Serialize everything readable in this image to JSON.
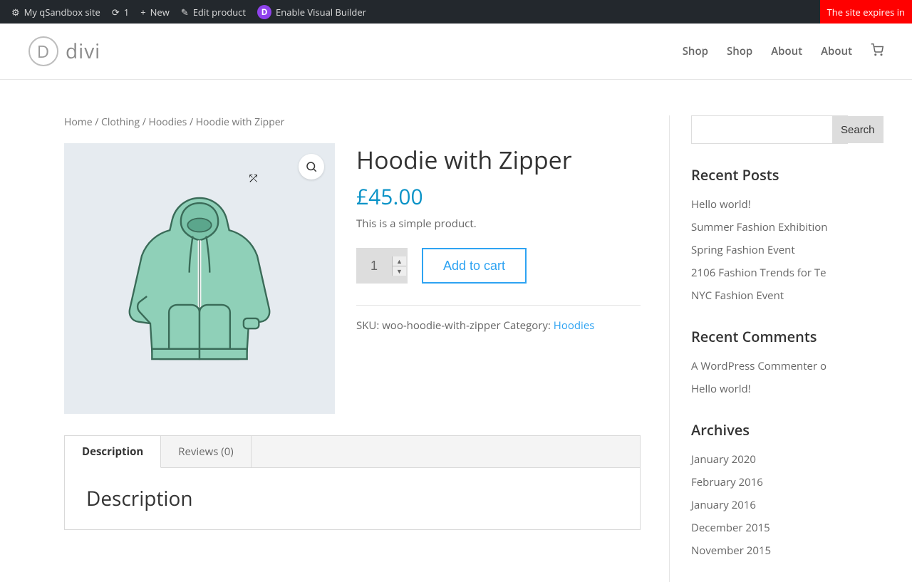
{
  "admin_bar": {
    "site_name": "My qSandbox site",
    "updates_count": "1",
    "new_label": "New",
    "edit_label": "Edit product",
    "visual_builder": "Enable Visual Builder",
    "expire_notice": "The site expires in"
  },
  "logo_text": "divi",
  "nav": [
    "Shop",
    "Shop",
    "About",
    "About"
  ],
  "breadcrumb": {
    "home": "Home",
    "cat1": "Clothing",
    "cat2": "Hoodies",
    "current": "Hoodie with Zipper",
    "sep": " / "
  },
  "product": {
    "title": "Hoodie with Zipper",
    "price": "£45.00",
    "short_desc": "This is a simple product.",
    "qty": "1",
    "add_to_cart": "Add to cart",
    "sku_label": "SKU: ",
    "sku": "woo-hoodie-with-zipper",
    "cat_label": " Category: ",
    "cat_link": "Hoodies"
  },
  "tabs": {
    "desc": "Description",
    "reviews": "Reviews (0)",
    "panel_heading": "Description"
  },
  "sidebar": {
    "search_btn": "Search",
    "recent_posts_title": "Recent Posts",
    "recent_posts": [
      "Hello world!",
      "Summer Fashion Exhibition",
      "Spring Fashion Event",
      "2106 Fashion Trends for Te",
      "NYC Fashion Event"
    ],
    "recent_comments_title": "Recent Comments",
    "recent_comments": [
      "A WordPress Commenter o",
      "Hello world!"
    ],
    "archives_title": "Archives",
    "archives": [
      "January 2020",
      "February 2016",
      "January 2016",
      "December 2015",
      "November 2015"
    ]
  }
}
